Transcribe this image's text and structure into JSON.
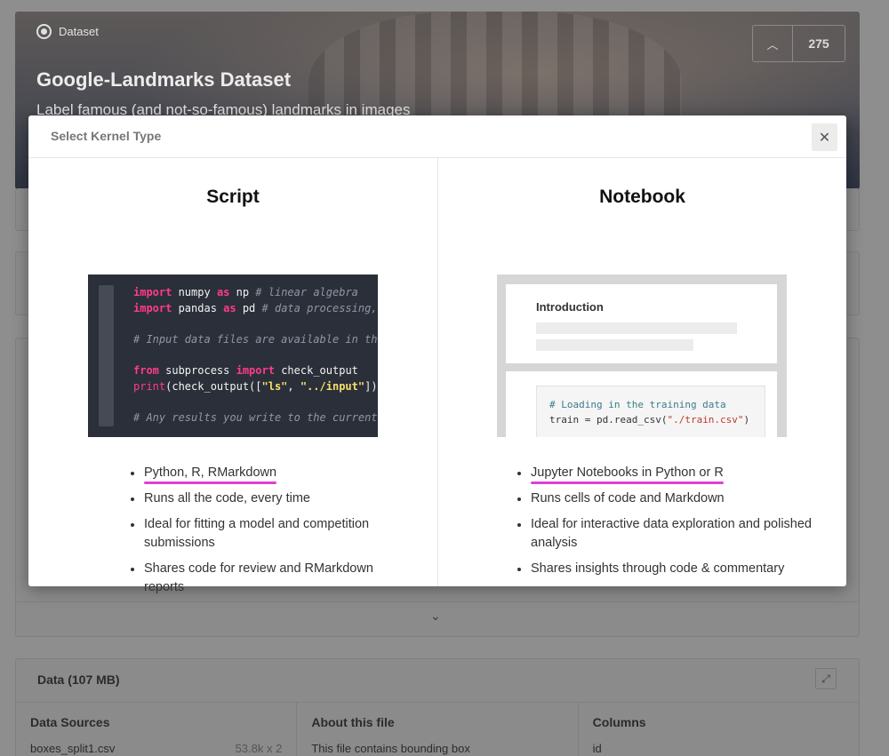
{
  "hero": {
    "type_label": "Dataset",
    "title": "Google-Landmarks Dataset",
    "subtitle": "Label famous (and not-so-famous) landmarks in images",
    "upvote_icon": "chevron-up-icon",
    "vote_count": "275"
  },
  "collapse_icon": "chevron-down-icon",
  "data_section": {
    "title": "Data (107 MB)",
    "expand_icon": "expand-icon",
    "columns": [
      {
        "heading": "Data Sources",
        "item_name": "boxes_split1.csv",
        "item_meta": "53.8k x 2"
      },
      {
        "heading": "About this file",
        "text": "This file contains bounding box"
      },
      {
        "heading": "Columns",
        "item_name": "id"
      }
    ]
  },
  "modal": {
    "title": "Select Kernel Type",
    "close_icon": "close-icon",
    "script": {
      "heading": "Script",
      "code": {
        "line1": {
          "kw1": "import",
          "t1": " numpy ",
          "kw2": "as",
          "t2": " np ",
          "cm": "# linear algebra"
        },
        "line2": {
          "kw1": "import",
          "t1": " pandas ",
          "kw2": "as",
          "t2": " pd ",
          "cm": "# data processing,"
        },
        "line3": {
          "cm": "# Input data files are available in th"
        },
        "line4": {
          "kw1": "from",
          "t1": " subprocess ",
          "kw2": "import",
          "t2": " check_output"
        },
        "line5": {
          "fn": "print",
          "t1": "(check_output([",
          "s1": "\"ls\"",
          "t2": ", ",
          "s2": "\"../input\"",
          "t3": "])"
        },
        "line6": {
          "cm": "# Any results you write to the current"
        }
      },
      "features": [
        "Python, R, RMarkdown",
        "Runs all the code, every time",
        "Ideal for fitting a model and competition submissions",
        "Shares code for review and RMarkdown reports"
      ]
    },
    "notebook": {
      "heading": "Notebook",
      "preview": {
        "intro": "Introduction",
        "code_comment": "# Loading in the training data",
        "code_pre": "train = pd.read_csv(",
        "code_str": "\"./train.csv\"",
        "code_post": ")"
      },
      "features": [
        "Jupyter Notebooks in Python or R",
        "Runs cells of code and Markdown",
        "Ideal for interactive data exploration and polished analysis",
        "Shares insights through code & commentary"
      ]
    }
  },
  "colors": {
    "highlight": "#e040d8",
    "code_bg": "#2b2f3a",
    "keyword": "#ff3b8a",
    "string": "#f3e06a"
  }
}
